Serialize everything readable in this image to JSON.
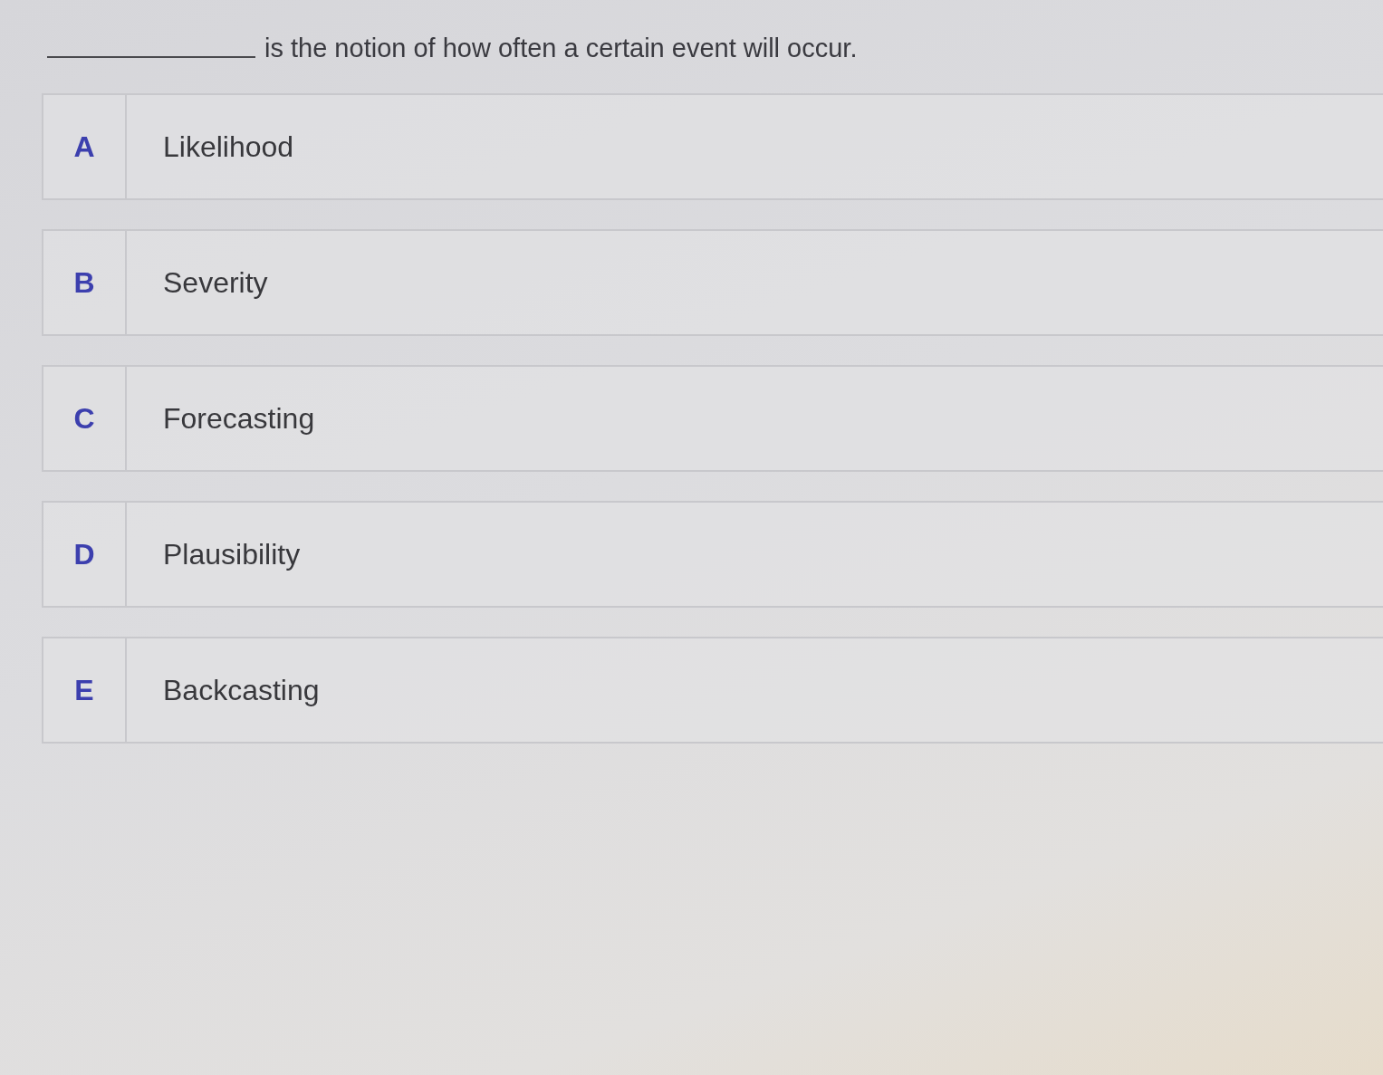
{
  "question": {
    "text": "is the notion of how often a certain event will occur."
  },
  "options": [
    {
      "letter": "A",
      "label": "Likelihood"
    },
    {
      "letter": "B",
      "label": "Severity"
    },
    {
      "letter": "C",
      "label": "Forecasting"
    },
    {
      "letter": "D",
      "label": "Plausibility"
    },
    {
      "letter": "E",
      "label": "Backcasting"
    }
  ]
}
